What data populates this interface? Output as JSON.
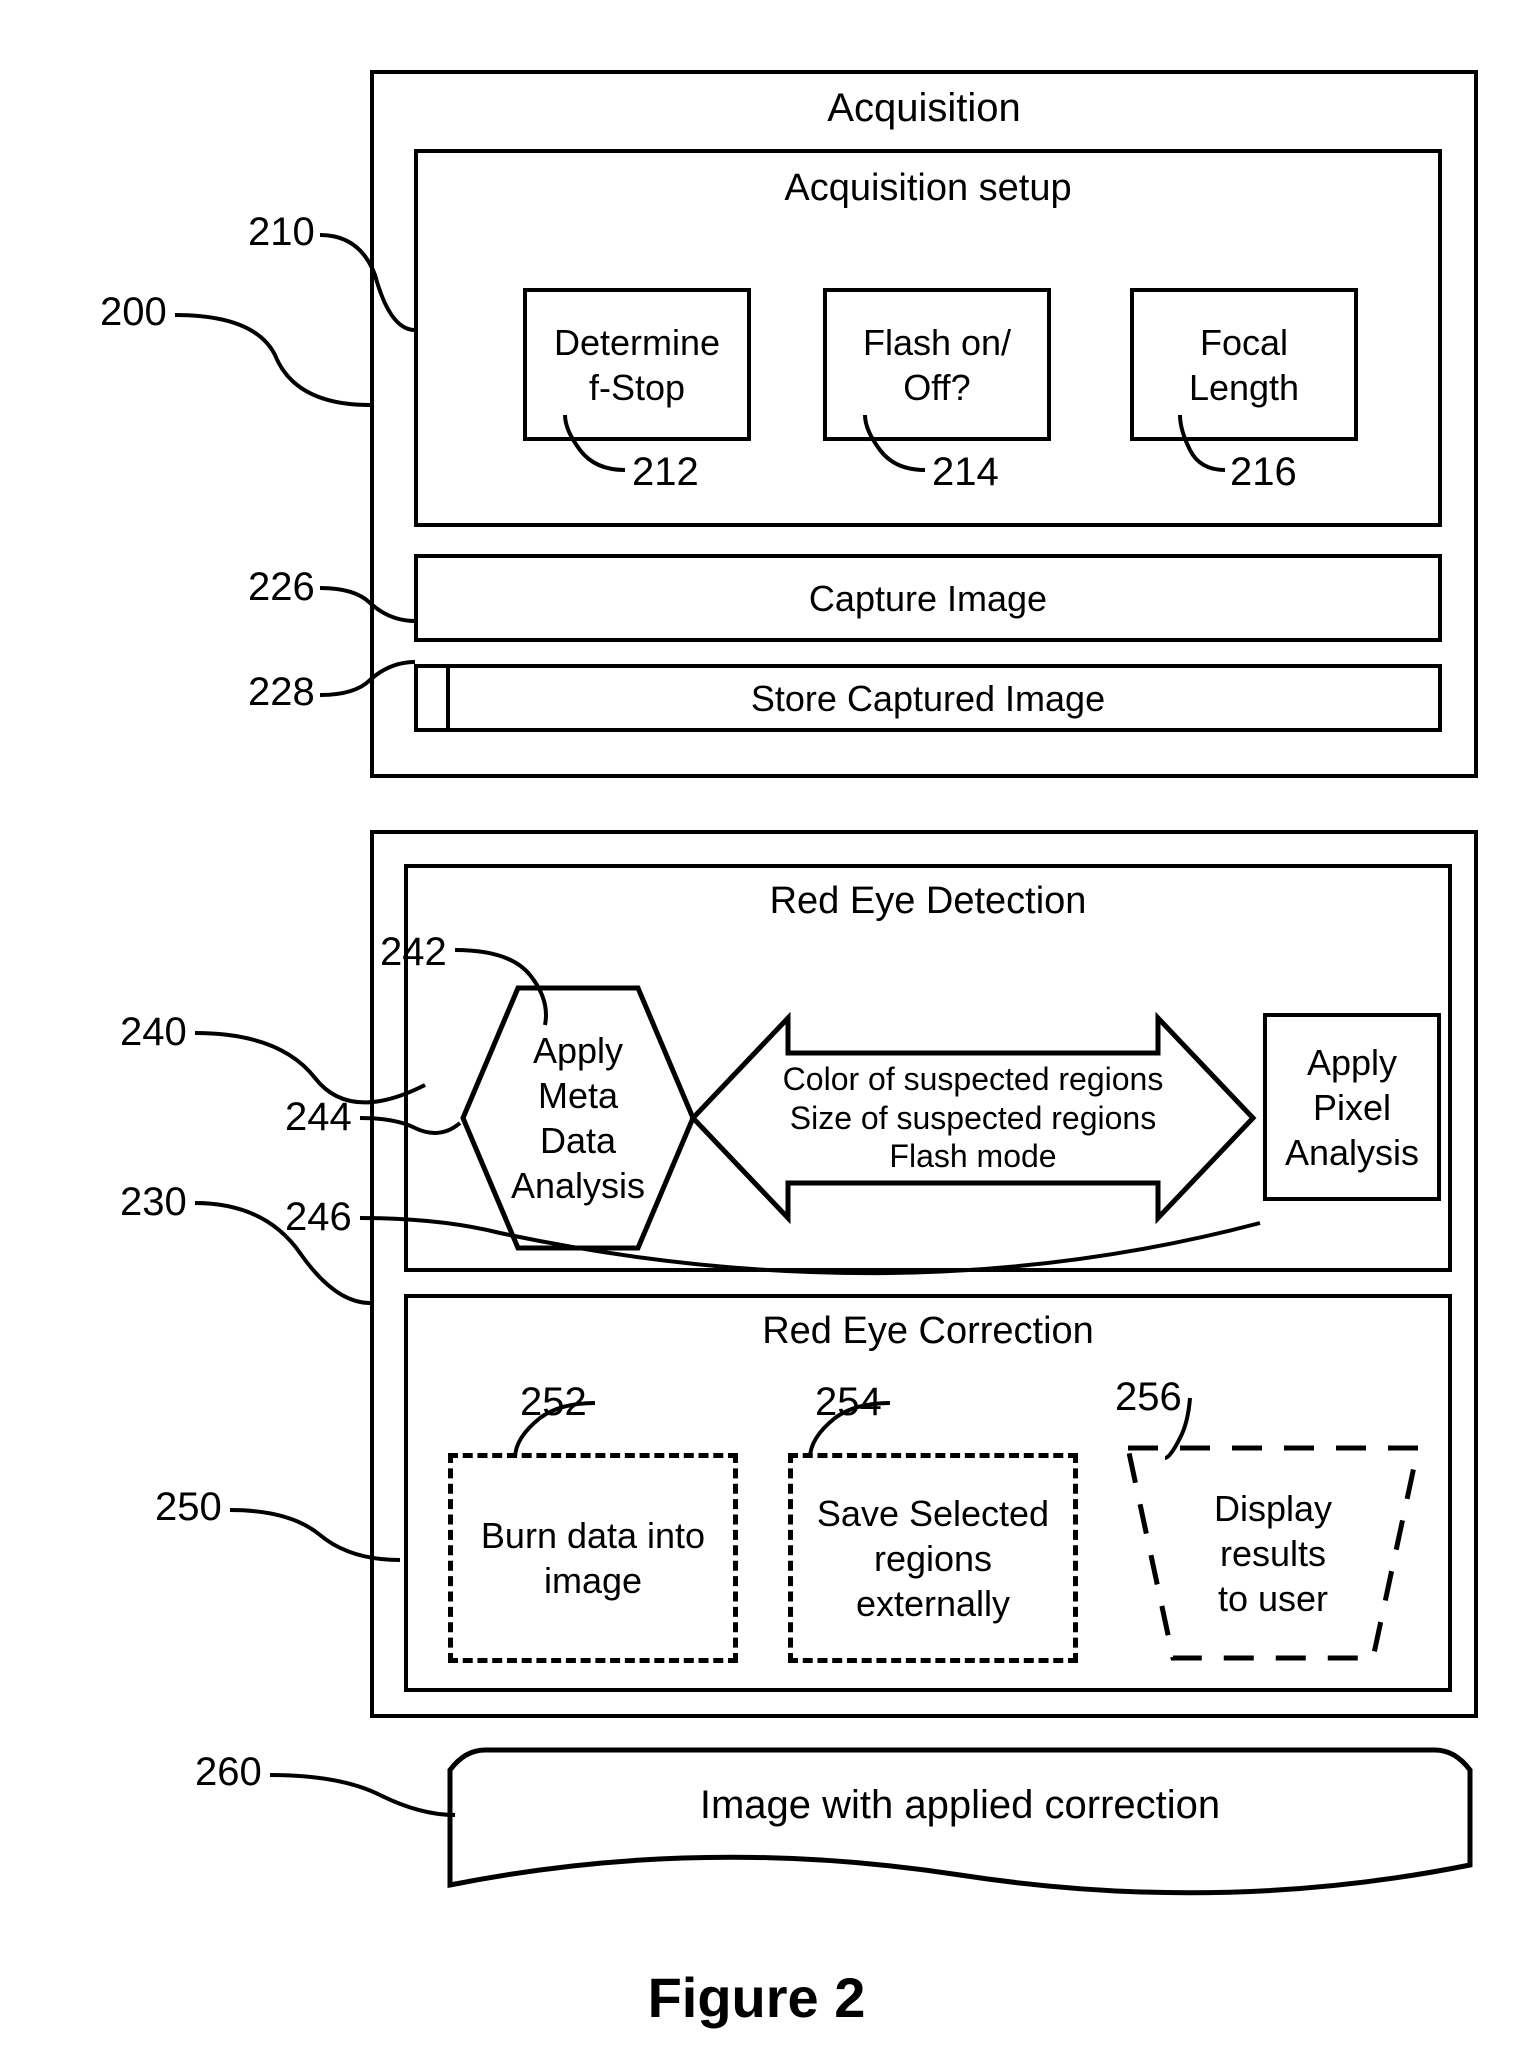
{
  "figure_caption": "Figure 2",
  "labels": {
    "n200": "200",
    "n210": "210",
    "n212": "212",
    "n214": "214",
    "n216": "216",
    "n226": "226",
    "n228": "228",
    "n230": "230",
    "n240": "240",
    "n242": "242",
    "n244": "244",
    "n246": "246",
    "n250": "250",
    "n252": "252",
    "n254": "254",
    "n256": "256",
    "n260": "260"
  },
  "acquisition": {
    "title": "Acquisition",
    "setup_title": "Acquisition setup",
    "fstop": "Determine\nf-Stop",
    "flash": "Flash on/\nOff?",
    "focal": "Focal\nLength",
    "capture": "Capture Image",
    "store": "Store Captured Image"
  },
  "detection": {
    "title": "Red Eye Detection",
    "meta": "Apply\nMeta\nData\nAnalysis",
    "arrow_text": "Color of suspected regions Size of suspected regions Flash mode",
    "pixel": "Apply\nPixel\nAnalysis"
  },
  "correction": {
    "title": "Red Eye Correction",
    "burn": "Burn data into image",
    "save": "Save Selected regions externally",
    "display": "Display\nresults\nto user"
  },
  "output": {
    "text": "Image with applied correction"
  }
}
